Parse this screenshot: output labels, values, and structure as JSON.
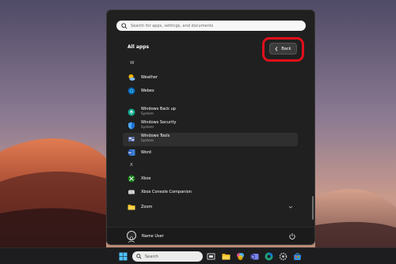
{
  "search": {
    "placeholder": "Search for apps, settings, and documents"
  },
  "all_apps": {
    "title": "All apps",
    "back_label": "Back"
  },
  "letters": {
    "w": "W",
    "x": "X",
    "z": "Z"
  },
  "apps": {
    "weather": {
      "name": "Weather"
    },
    "webex": {
      "name": "Webex"
    },
    "windows_backup": {
      "name": "Windows Back up",
      "sub": "System"
    },
    "windows_security": {
      "name": "Windows Security",
      "sub": "System"
    },
    "windows_tools": {
      "name": "Windows Tools",
      "sub": "System"
    },
    "word": {
      "name": "Word"
    },
    "xbox": {
      "name": "Xbox"
    },
    "xbox_companion": {
      "name": "Xbox Console Companion"
    },
    "zoom": {
      "name": "Zoom"
    }
  },
  "user": {
    "name": "Name User"
  },
  "taskbar": {
    "search_label": "Search"
  },
  "colors": {
    "highlight_ring": "#e0101a",
    "menu_bg": "#202020",
    "accent": "#0a63c9"
  }
}
